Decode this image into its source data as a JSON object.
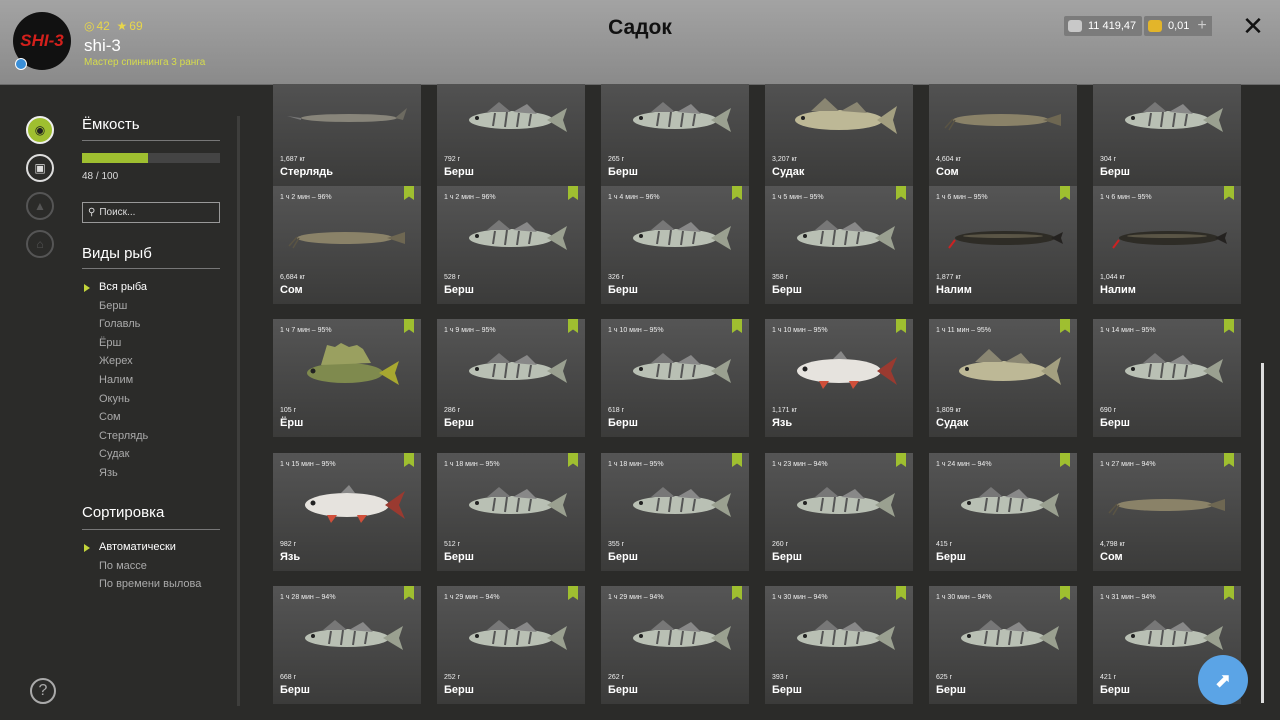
{
  "header": {
    "title": "Садок",
    "avatar_text": "SHI-3",
    "stat1": "42",
    "stat2": "69",
    "username": "shi-3",
    "rank": "Мастер спиннинга 3 ранга",
    "money1": "11 419,47",
    "money2": "0,01",
    "plus": "+",
    "close": "✕"
  },
  "sidebar": {
    "capacity_title": "Ёмкость",
    "capacity_value": "48 / 100",
    "capacity_fraction": 0.48,
    "search_placeholder": "Поиск...",
    "species_title": "Виды рыб",
    "species": [
      "Вся рыба",
      "Берш",
      "Голавль",
      "Ёрш",
      "Жерех",
      "Налим",
      "Окунь",
      "Сом",
      "Стерлядь",
      "Судак",
      "Язь"
    ],
    "sort_title": "Сортировка",
    "sort": [
      "Автоматически",
      "По массе",
      "По времени вылова"
    ],
    "help": "?"
  },
  "cards": [
    [
      {
        "t": "",
        "w": "1,687 кг",
        "n": "Стерлядь",
        "f": "sterlet"
      },
      {
        "t": "",
        "w": "792 г",
        "n": "Берш",
        "f": "bersh"
      },
      {
        "t": "",
        "w": "265 г",
        "n": "Берш",
        "f": "bersh"
      },
      {
        "t": "",
        "w": "3,207 кг",
        "n": "Судак",
        "f": "sudak"
      },
      {
        "t": "",
        "w": "4,604 кг",
        "n": "Сом",
        "f": "som"
      },
      {
        "t": "",
        "w": "304 г",
        "n": "Берш",
        "f": "bersh"
      }
    ],
    [
      {
        "t": "1 ч 2 мин – 96%",
        "w": "6,684 кг",
        "n": "Сом",
        "f": "som"
      },
      {
        "t": "1 ч 2 мин – 96%",
        "w": "528 г",
        "n": "Берш",
        "f": "bersh"
      },
      {
        "t": "1 ч 4 мин – 96%",
        "w": "326 г",
        "n": "Берш",
        "f": "bersh"
      },
      {
        "t": "1 ч 5 мин – 95%",
        "w": "358 г",
        "n": "Берш",
        "f": "bersh"
      },
      {
        "t": "1 ч 6 мин – 95%",
        "w": "1,877 кг",
        "n": "Налим",
        "f": "nalim"
      },
      {
        "t": "1 ч 6 мин – 95%",
        "w": "1,044 кг",
        "n": "Налим",
        "f": "nalim"
      }
    ],
    [
      {
        "t": "1 ч 7 мин – 95%",
        "w": "105 г",
        "n": "Ёрш",
        "f": "yorsh"
      },
      {
        "t": "1 ч 9 мин – 95%",
        "w": "286 г",
        "n": "Берш",
        "f": "bersh"
      },
      {
        "t": "1 ч 10 мин – 95%",
        "w": "618 г",
        "n": "Берш",
        "f": "bersh"
      },
      {
        "t": "1 ч 10 мин – 95%",
        "w": "1,171 кг",
        "n": "Язь",
        "f": "yaz"
      },
      {
        "t": "1 ч 11 мин – 95%",
        "w": "1,809 кг",
        "n": "Судак",
        "f": "sudak"
      },
      {
        "t": "1 ч 14 мин – 95%",
        "w": "690 г",
        "n": "Берш",
        "f": "bersh"
      }
    ],
    [
      {
        "t": "1 ч 15 мин – 95%",
        "w": "982 г",
        "n": "Язь",
        "f": "yaz"
      },
      {
        "t": "1 ч 18 мин – 95%",
        "w": "512 г",
        "n": "Берш",
        "f": "bersh"
      },
      {
        "t": "1 ч 18 мин – 95%",
        "w": "355 г",
        "n": "Берш",
        "f": "bersh"
      },
      {
        "t": "1 ч 23 мин – 94%",
        "w": "260 г",
        "n": "Берш",
        "f": "bersh"
      },
      {
        "t": "1 ч 24 мин – 94%",
        "w": "415 г",
        "n": "Берш",
        "f": "bersh"
      },
      {
        "t": "1 ч 27 мин – 94%",
        "w": "4,798 кг",
        "n": "Сом",
        "f": "som"
      }
    ],
    [
      {
        "t": "1 ч 28 мин – 94%",
        "w": "668 г",
        "n": "Берш",
        "f": "bersh"
      },
      {
        "t": "1 ч 29 мин – 94%",
        "w": "252 г",
        "n": "Берш",
        "f": "bersh"
      },
      {
        "t": "1 ч 29 мин – 94%",
        "w": "262 г",
        "n": "Берш",
        "f": "bersh"
      },
      {
        "t": "1 ч 30 мин – 94%",
        "w": "393 г",
        "n": "Берш",
        "f": "bersh"
      },
      {
        "t": "1 ч 30 мин – 94%",
        "w": "625 г",
        "n": "Берш",
        "f": "bersh"
      },
      {
        "t": "1 ч 31 мин – 94%",
        "w": "421 г",
        "n": "Берш",
        "f": "bersh"
      }
    ]
  ],
  "colors": {
    "accent": "#9fbf30",
    "fab": "#5ba4e6"
  }
}
